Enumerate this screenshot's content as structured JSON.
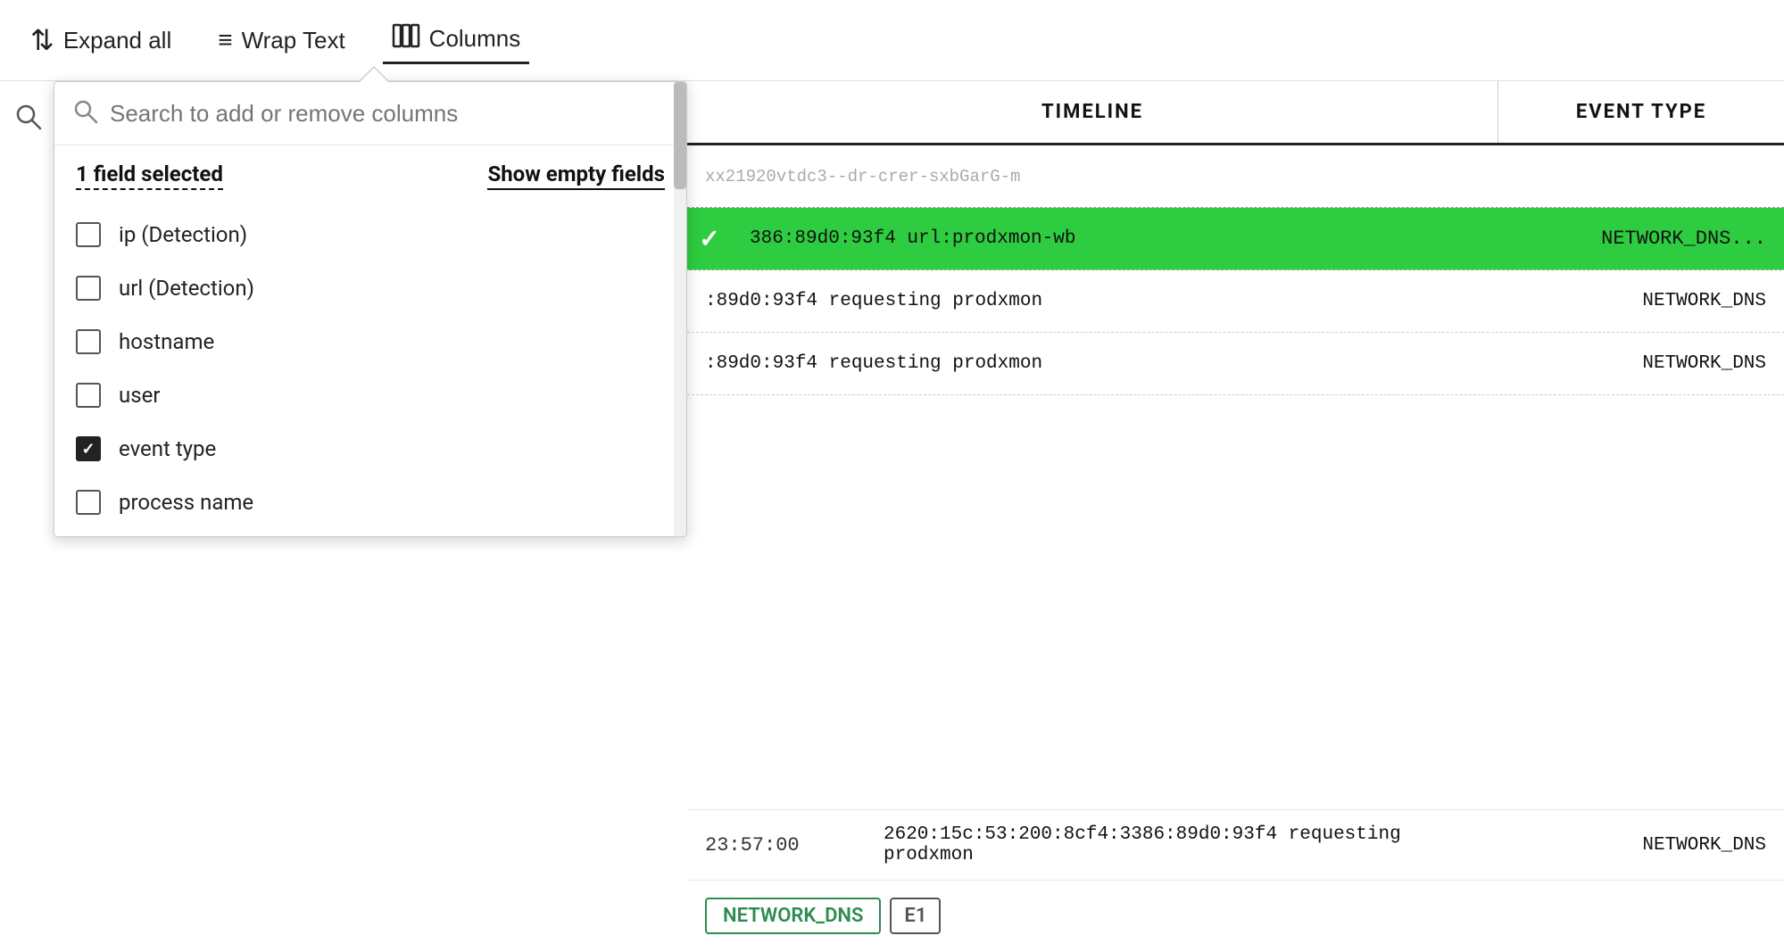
{
  "toolbar": {
    "expand_all_label": "Expand all",
    "wrap_text_label": "Wrap Text",
    "columns_label": "Columns"
  },
  "dropdown": {
    "search_placeholder": "Search to add or remove columns",
    "fields_selected_label": "1 field selected",
    "show_empty_label": "Show empty fields",
    "fields": [
      {
        "id": "ip_detection",
        "label": "ip (Detection)",
        "checked": false
      },
      {
        "id": "url_detection",
        "label": "url (Detection)",
        "checked": false
      },
      {
        "id": "hostname",
        "label": "hostname",
        "checked": false
      },
      {
        "id": "user",
        "label": "user",
        "checked": false
      },
      {
        "id": "event_type",
        "label": "event type",
        "checked": true
      },
      {
        "id": "process_name",
        "label": "process name",
        "checked": false
      }
    ]
  },
  "table": {
    "col_timeline": "TIMELINE",
    "col_event_type": "EVENT TYPE",
    "rows": [
      {
        "id": "row1",
        "content": "xx21920vtdc3--dr-crer-sxbGarG-m",
        "event_type": "",
        "highlighted": false,
        "dashed": true
      },
      {
        "id": "row2",
        "content": "386:89d0:93f4 url:prodxmon-wb",
        "event_type": "NETWORK_DNS...",
        "highlighted": true
      },
      {
        "id": "row3",
        "content": ":89d0:93f4 requesting prodxmon",
        "event_type": "NETWORK_DNS",
        "highlighted": false
      },
      {
        "id": "row4",
        "content": ":89d0:93f4 requesting prodxmon",
        "event_type": "NETWORK_DNS",
        "highlighted": false
      }
    ]
  },
  "bottom_row": {
    "timestamp": "23:57:00",
    "content": "2620:15c:53:200:8cf4:3386:89d0:93f4 requesting prodxmon",
    "event_type": "NETWORK_DNS",
    "badges": [
      "NETWORK_DNS",
      "E1"
    ]
  }
}
